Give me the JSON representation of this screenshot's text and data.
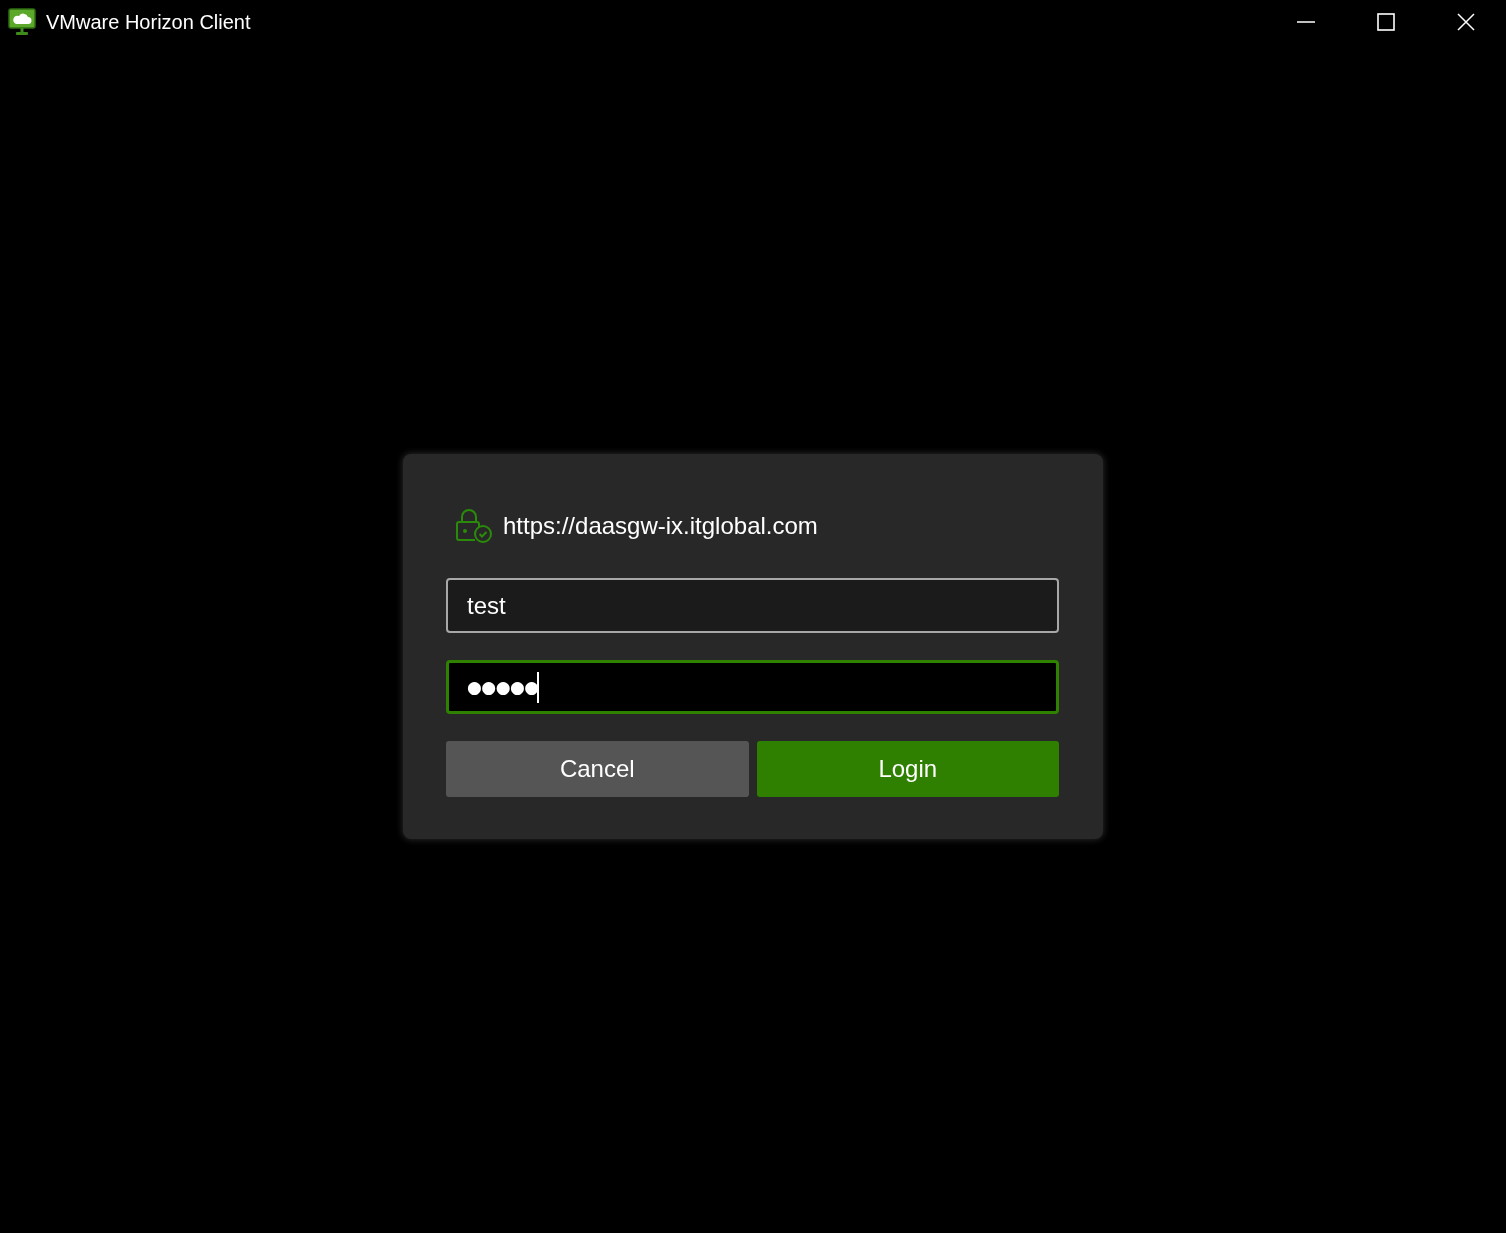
{
  "window": {
    "title": "VMware Horizon Client"
  },
  "login": {
    "server_url": "https://daasgw-ix.itglobal.com",
    "fields": [
      {
        "kind": "username",
        "value": "test",
        "focused": false
      },
      {
        "kind": "password",
        "value": "●●●●●",
        "focused": true
      }
    ],
    "buttons": [
      {
        "label": "Cancel",
        "kind": "secondary"
      },
      {
        "label": "Login",
        "kind": "primary"
      }
    ]
  }
}
